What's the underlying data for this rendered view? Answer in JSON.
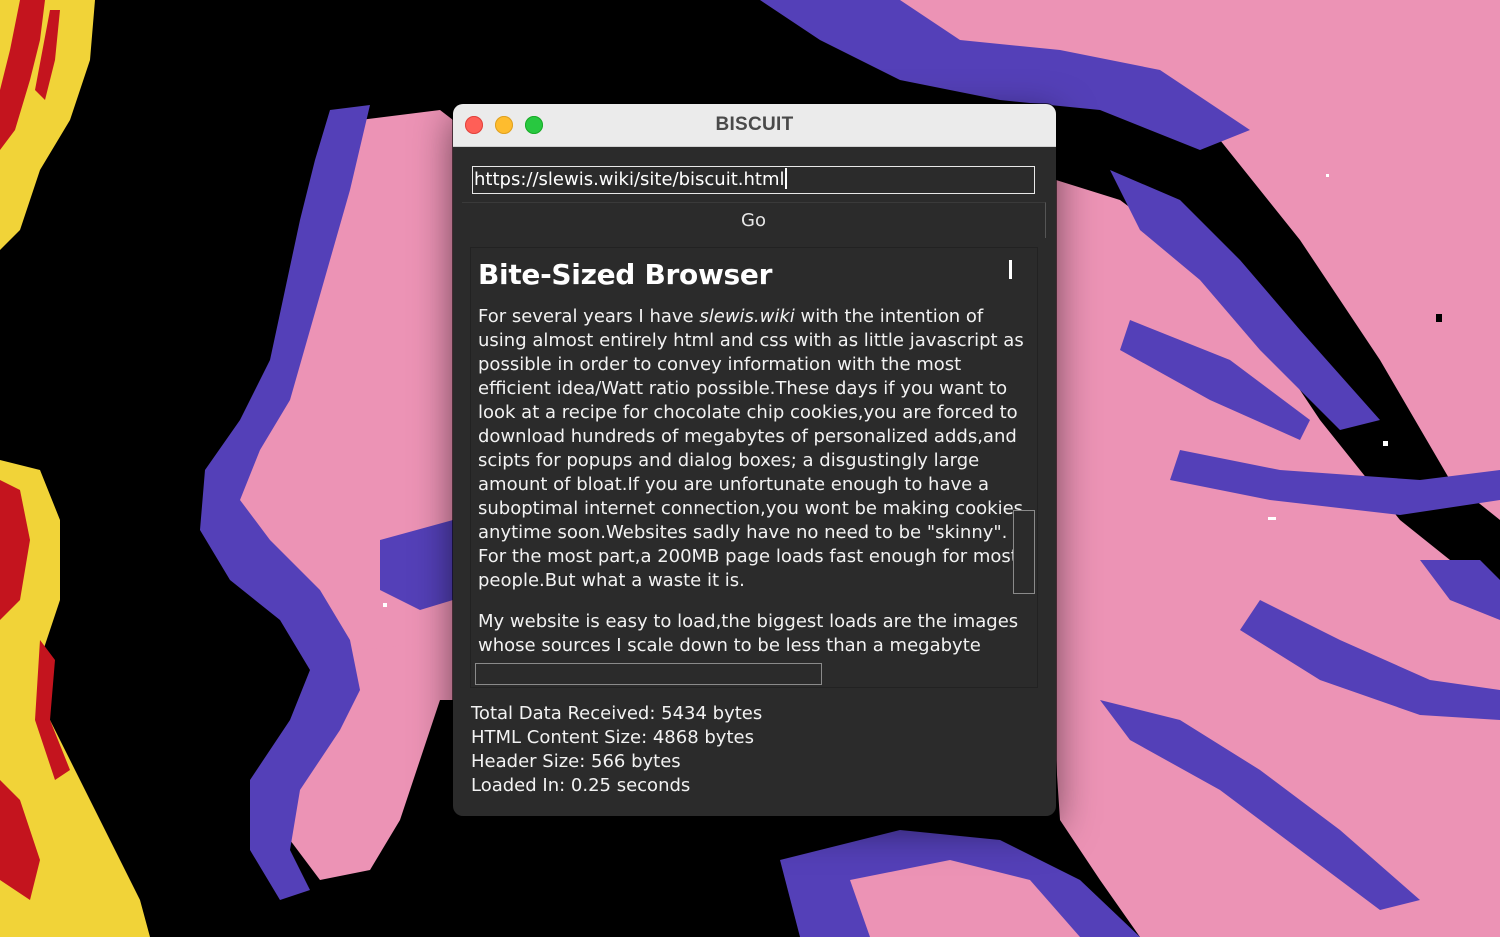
{
  "window": {
    "title": "BISCUIT"
  },
  "address_bar": {
    "value": "https://slewis.wiki/site/biscuit.html"
  },
  "go_button": {
    "label": "Go"
  },
  "page": {
    "heading": "Bite-Sized Browser",
    "p1_lines": [
      {
        "before": "For several years I have ",
        "em": "slewis.wiki",
        "after": " with the intention of"
      },
      {
        "text": "using almost entirely html and css with as little javascript as"
      },
      {
        "text": "possible in order to convey information with the most"
      },
      {
        "text": "efficient idea/Watt ratio possible.These days if you want to"
      },
      {
        "text": "look at a recipe for chocolate chip cookies,you are forced to"
      },
      {
        "text": "download hundreds of megabytes of personalized adds,and"
      },
      {
        "text": "scipts for popups and dialog boxes; a disgustingly large"
      },
      {
        "text": "amount of bloat.If you are unfortunate enough to have a"
      },
      {
        "text": "suboptimal internet connection,you wont be making cookies"
      },
      {
        "text": "anytime soon.Websites sadly have no need to be \"skinny\"."
      },
      {
        "text": "For the most part,a 200MB page loads fast enough for most"
      },
      {
        "text": "people.But what a waste it is."
      }
    ],
    "p2_lines": [
      "My website is easy to load,the biggest loads are the images",
      "whose sources I scale down to be less than a megabyte"
    ]
  },
  "stats": {
    "total": "Total Data Received: 5434 bytes",
    "html_size": "HTML Content Size: 4868 bytes",
    "header_size": "Header Size: 566 bytes",
    "loaded_in": "Loaded In: 0.25 seconds"
  },
  "colors": {
    "wallpaper_black": "#000000",
    "wallpaper_pink": "#ec93b5",
    "wallpaper_purple": "#5440b8",
    "wallpaper_red": "#c4141e",
    "wallpaper_yellow": "#f1d338",
    "window_bg": "#2b2b2b",
    "titlebar_bg": "#ebebeb"
  }
}
